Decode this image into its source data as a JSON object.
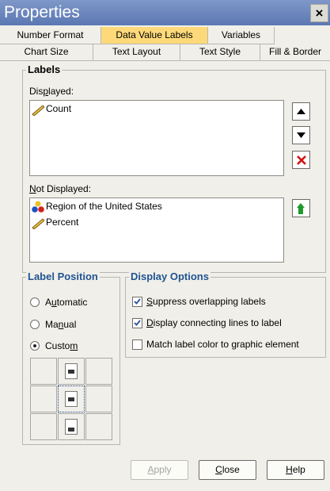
{
  "window": {
    "title": "Properties",
    "close_label": "×"
  },
  "tabs_row1": [
    {
      "label": "Number Format",
      "active": false
    },
    {
      "label": "Data Value Labels",
      "active": true
    },
    {
      "label": "Variables",
      "active": false
    }
  ],
  "tabs_row2": [
    {
      "label": "Chart Size"
    },
    {
      "label": "Text Layout"
    },
    {
      "label": "Text Style"
    },
    {
      "label": "Fill & Border"
    }
  ],
  "labels_group": {
    "legend": "Labels",
    "displayed": {
      "label_pre": "Dis",
      "label_u": "p",
      "label_post": "layed:",
      "items": [
        {
          "label": "Count",
          "icon": "scale-icon"
        }
      ]
    },
    "not_displayed": {
      "label_pre": "",
      "label_u": "N",
      "label_post": "ot Displayed:",
      "items": [
        {
          "label": "Region of the United States",
          "icon": "nominal-icon"
        },
        {
          "label": "Percent",
          "icon": "scale-icon"
        }
      ]
    }
  },
  "label_position": {
    "legend": "Label Position",
    "options": [
      {
        "pre": "A",
        "u": "u",
        "post": "tomatic",
        "checked": false
      },
      {
        "pre": "Ma",
        "u": "n",
        "post": "ual",
        "checked": false
      },
      {
        "pre": "Custo",
        "u": "m",
        "post": "",
        "checked": true
      }
    ]
  },
  "display_options": {
    "legend": "Display Options",
    "options": [
      {
        "pre": "",
        "u": "S",
        "post": "uppress overlapping labels",
        "checked": true
      },
      {
        "pre": "",
        "u": "D",
        "post": "isplay connecting lines to label",
        "checked": true
      },
      {
        "pre": "",
        "u": "",
        "post": "Match label color to graphic element",
        "checked": false
      }
    ]
  },
  "buttons": {
    "apply": {
      "pre": "",
      "u": "A",
      "post": "pply"
    },
    "close": {
      "pre": "",
      "u": "C",
      "post": "lose"
    },
    "help": {
      "pre": "",
      "u": "H",
      "post": "elp"
    }
  }
}
